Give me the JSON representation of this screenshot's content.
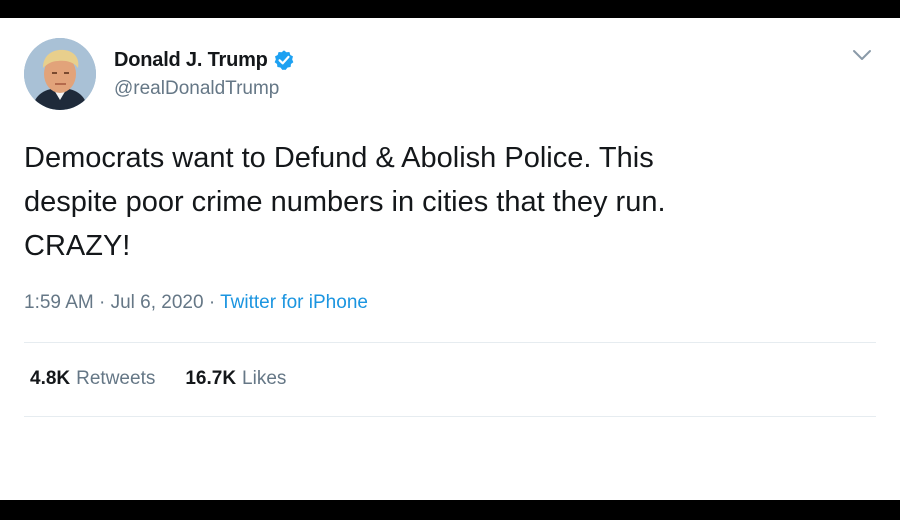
{
  "tweet": {
    "display_name": "Donald J. Trump",
    "handle": "@realDonaldTrump",
    "verified": true,
    "text": "Democrats want to Defund & Abolish Police. This\ndespite poor crime numbers in cities that they run.\nCRAZY!",
    "timestamp": "1:59 AM · Jul 6, 2020",
    "separator": "·",
    "source": "Twitter for iPhone",
    "retweets_count": "4.8K",
    "retweets_label": "Retweets",
    "likes_count": "16.7K",
    "likes_label": "Likes"
  },
  "icons": {
    "verified": "verified-badge-icon",
    "menu": "chevron-down-icon"
  },
  "colors": {
    "text_primary": "#14171a",
    "text_secondary": "#657786",
    "link": "#1b95e0",
    "verified_blue": "#1da1f2",
    "divider": "#e6ecf0"
  }
}
